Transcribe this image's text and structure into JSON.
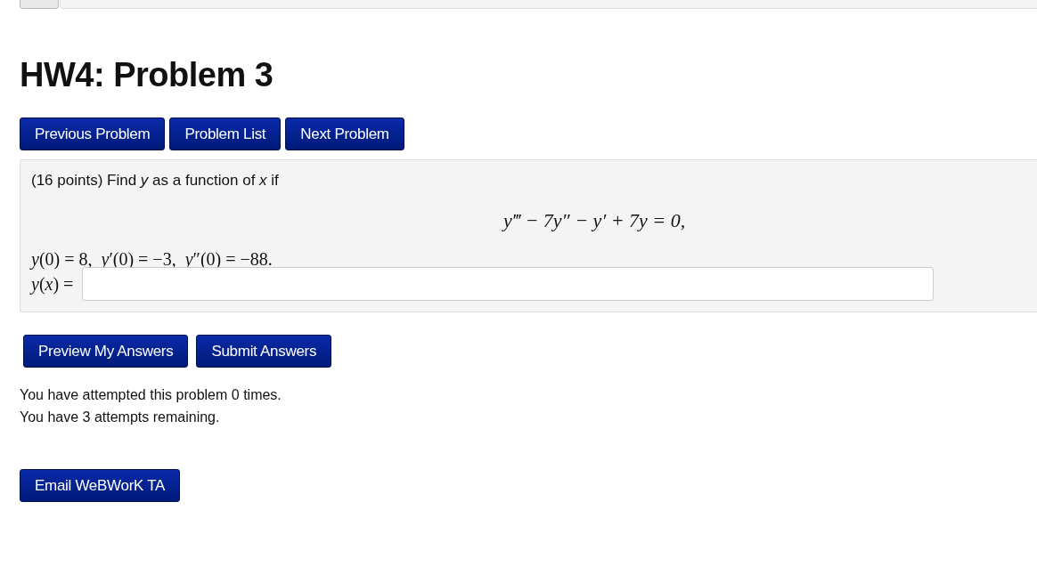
{
  "title": "HW4: Problem 3",
  "nav_buttons": [
    "Previous Problem",
    "Problem List",
    "Next Problem"
  ],
  "problem": {
    "statement": "(16 points) Find *y* as a function of *x* if",
    "equation": "y‴ − 7y″ − y′ + 7y = 0,",
    "conditions": "*y*(0) = 8,  *y*′(0) = −3,  *y*″(0) = −88.",
    "answer_label": "*y*(*x*) ="
  },
  "answer_buttons": [
    "Preview My Answers",
    "Submit Answers"
  ],
  "attempts": [
    "You have attempted this problem 0 times.",
    "You have 3 attempts remaining."
  ],
  "email_button": "Email WeBWorK TA"
}
